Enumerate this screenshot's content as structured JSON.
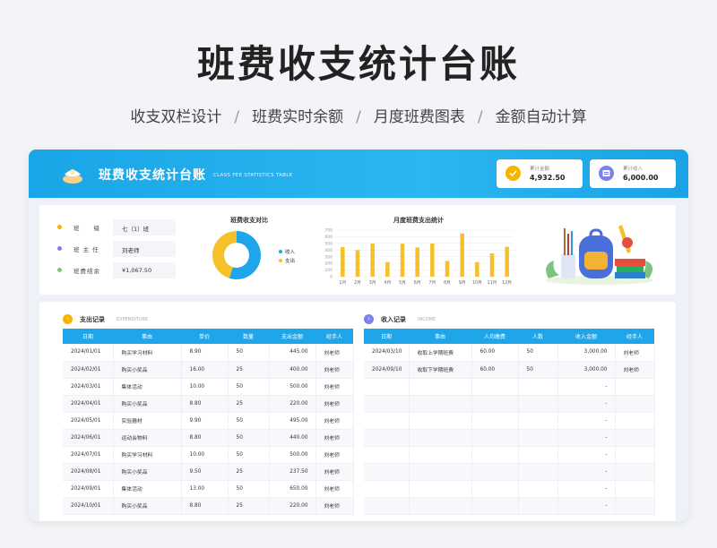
{
  "hero": {
    "title": "班费收支统计台账",
    "features": [
      "收支双栏设计",
      "班费实时余额",
      "月度班费图表",
      "金额自动计算"
    ],
    "separator": "/"
  },
  "banner": {
    "title": "班费收支统计台账",
    "subtitle_en": "CLASS FEE STATISTICS TABLE",
    "stats": [
      {
        "label": "累计金额",
        "value": "4,932.50",
        "icon": "coin-icon",
        "color": "#f5b400"
      },
      {
        "label": "累计收入",
        "value": "6,000.00",
        "icon": "wallet-icon",
        "color": "#7b83ea"
      }
    ]
  },
  "info": {
    "rows": [
      {
        "key": "班　　级",
        "value": "七（1）班",
        "color": "#f5b400"
      },
      {
        "key": "班 主 任",
        "value": "刘老师",
        "color": "#7b83ea"
      },
      {
        "key": "班费结余",
        "value": "¥1,067.50",
        "color": "#7cc47f"
      }
    ]
  },
  "donut": {
    "title": "班费收支对比",
    "legend": [
      {
        "label": "收入",
        "color": "#1fa5ea"
      },
      {
        "label": "支出",
        "color": "#f5c02a"
      }
    ],
    "values": [
      6000,
      4932.5
    ]
  },
  "chart_data": {
    "type": "bar",
    "title": "月度班费支出统计",
    "categories": [
      "1月",
      "2月",
      "3月",
      "4月",
      "5月",
      "6月",
      "7月",
      "8月",
      "9月",
      "10月",
      "11月",
      "12月"
    ],
    "values": [
      445,
      400,
      500,
      220,
      495,
      440,
      500,
      237.5,
      650,
      220,
      350,
      450
    ],
    "ylim": [
      0,
      700
    ],
    "yticks": [
      "0",
      "100",
      "200",
      "300",
      "400",
      "500",
      "600",
      "700"
    ],
    "color": "#f5c02a",
    "grid": true
  },
  "expenditure": {
    "title": "支出记录",
    "title_en": "EXPENDITURE",
    "columns": [
      "日期",
      "事由",
      "单价",
      "数量",
      "支出金额",
      "经手人"
    ],
    "rows": [
      [
        "2024/01/01",
        "购买学习材料",
        "8.90",
        "50",
        "445.00",
        "刘老师"
      ],
      [
        "2024/02/01",
        "购买小奖品",
        "16.00",
        "25",
        "400.00",
        "刘老师"
      ],
      [
        "2024/03/01",
        "集体活动",
        "10.00",
        "50",
        "500.00",
        "刘老师"
      ],
      [
        "2024/04/01",
        "购买小奖品",
        "8.80",
        "25",
        "220.00",
        "刘老师"
      ],
      [
        "2024/05/01",
        "实验器材",
        "9.90",
        "50",
        "495.00",
        "刘老师"
      ],
      [
        "2024/06/01",
        "运动会物料",
        "8.80",
        "50",
        "440.00",
        "刘老师"
      ],
      [
        "2024/07/01",
        "购买学习材料",
        "10.00",
        "50",
        "500.00",
        "刘老师"
      ],
      [
        "2024/08/01",
        "购买小奖品",
        "9.50",
        "25",
        "237.50",
        "刘老师"
      ],
      [
        "2024/09/01",
        "集体活动",
        "13.00",
        "50",
        "650.00",
        "刘老师"
      ],
      [
        "2024/10/01",
        "购买小奖品",
        "8.80",
        "25",
        "220.00",
        "刘老师"
      ]
    ]
  },
  "income": {
    "title": "收入记录",
    "title_en": "INCOME",
    "columns": [
      "日期",
      "事由",
      "人均缴费",
      "人数",
      "收入金额",
      "经手人"
    ],
    "rows": [
      [
        "2024/03/10",
        "收取上学期班费",
        "60.00",
        "50",
        "3,000.00",
        "刘老师"
      ],
      [
        "2024/09/10",
        "收取下学期班费",
        "60.00",
        "50",
        "3,000.00",
        "刘老师"
      ],
      [
        "",
        "",
        "",
        "",
        "-",
        ""
      ],
      [
        "",
        "",
        "",
        "",
        "-",
        ""
      ],
      [
        "",
        "",
        "",
        "",
        "-",
        ""
      ],
      [
        "",
        "",
        "",
        "",
        "-",
        ""
      ],
      [
        "",
        "",
        "",
        "",
        "-",
        ""
      ],
      [
        "",
        "",
        "",
        "",
        "-",
        ""
      ],
      [
        "",
        "",
        "",
        "",
        "-",
        ""
      ],
      [
        "",
        "",
        "",
        "",
        "-",
        ""
      ]
    ]
  }
}
